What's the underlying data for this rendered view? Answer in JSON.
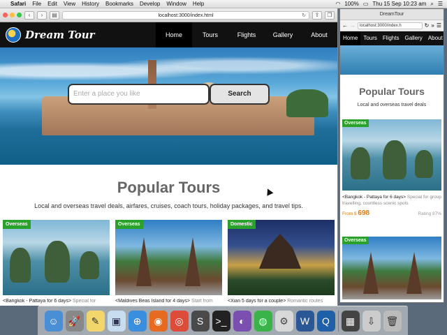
{
  "menubar": {
    "app": "Safari",
    "items": [
      "File",
      "Edit",
      "View",
      "History",
      "Bookmarks",
      "Develop",
      "Window",
      "Help"
    ],
    "battery": "100%",
    "datetime": "Thu 15 Sep  10:23 am"
  },
  "browser1": {
    "url": "localhost:3000/index.html"
  },
  "site": {
    "logo_text": "Dream Tour",
    "nav": [
      "Home",
      "Tours",
      "Flights",
      "Gallery",
      "About"
    ],
    "search_placeholder": "Enter a place you like",
    "search_button": "Search",
    "section_title": "Popular Tours",
    "section_subtitle": "Local and overseas travel deals, airfares, cruises, coach tours, holiday packages, and travel tips.",
    "cards": [
      {
        "badge": "Overseas",
        "title": "<Bangkok - Pattaya for 6 days>",
        "desc": "Special for"
      },
      {
        "badge": "Overseas",
        "title": "<Maldives Beas Island for 4 days>",
        "desc": "Start from"
      },
      {
        "badge": "Domestic",
        "title": "<Xian 5 days for a couple>",
        "desc": "Romantic routes"
      }
    ]
  },
  "browser2": {
    "tab_title": "DreamTour",
    "url": "localhost:3000/index.h",
    "nav": [
      "Home",
      "Tours",
      "Flights",
      "Gallery",
      "About"
    ],
    "section_title": "Popular Tours",
    "section_subtitle": "Local and overseas travel deals",
    "card1": {
      "badge": "Overseas",
      "title": "<Bangkok - Pattaya for 6 days>",
      "desc": "Special for group travelling, countless scenic spots",
      "from_label": "From $",
      "price": "698",
      "rating": "Rating 87%"
    },
    "card2": {
      "badge": "Overseas"
    }
  },
  "colors": {
    "nav_bg": "#111111",
    "badge_green": "#2aa12a",
    "price_orange": "#e07a10"
  },
  "dock": [
    "finder-icon",
    "launchpad-icon",
    "notes-icon",
    "preview-icon",
    "safari-icon",
    "firefox-icon",
    "chrome-icon",
    "sublime-icon",
    "terminal-icon",
    "github-icon",
    "wechat-icon",
    "tool-icon",
    "word-icon",
    "quicktime-icon",
    "finder-window-icon",
    "downloads-icon",
    "trash-icon"
  ]
}
